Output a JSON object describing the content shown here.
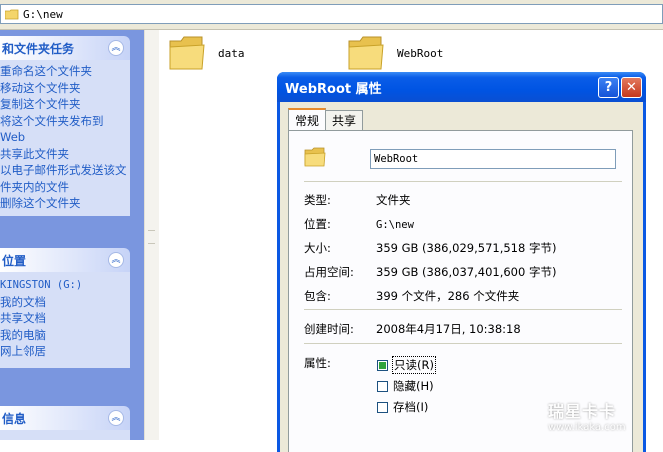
{
  "address": {
    "path": "G:\\new"
  },
  "taskpane": {
    "file_tasks": {
      "title": "和文件夹任务",
      "items": [
        "重命名这个文件夹",
        "移动这个文件夹",
        "复制这个文件夹",
        "将这个文件夹发布到 Web",
        "共享此文件夹",
        "以电子邮件形式发送该文件夹内的文件",
        "删除这个文件夹"
      ]
    },
    "other_places": {
      "title": "位置",
      "items": [
        "KINGSTON (G:)",
        "我的文档",
        "共享文档",
        "我的电脑",
        "网上邻居"
      ]
    },
    "details": {
      "title": "信息"
    }
  },
  "folders": [
    {
      "name": "data"
    },
    {
      "name": "WebRoot"
    }
  ],
  "dialog": {
    "title": "WebRoot 属性",
    "help_label": "?",
    "close_label": "✕",
    "tabs": [
      "常规",
      "共享"
    ],
    "name_value": "WebRoot",
    "rows": {
      "type": {
        "label": "类型:",
        "value": "文件夹"
      },
      "location": {
        "label": "位置:",
        "value": "G:\\new"
      },
      "size": {
        "label": "大小:",
        "value": "359 GB (386,029,571,518 字节)"
      },
      "size_on_disk": {
        "label": "占用空间:",
        "value": "359 GB (386,037,401,600 字节)"
      },
      "contains": {
        "label": "包含:",
        "value": "399 个文件，286 个文件夹"
      },
      "created": {
        "label": "创建时间:",
        "value": "2008年4月17日, 10:38:18"
      },
      "attributes": {
        "label": "属性:"
      }
    },
    "attributes": [
      {
        "label": "只读(R)",
        "state": "mixed"
      },
      {
        "label": "隐藏(H)",
        "state": "unchecked"
      },
      {
        "label": "存档(I)",
        "state": "unchecked"
      }
    ]
  },
  "watermark": {
    "top": "瑞星卡卡",
    "bottom": "www.ikaka.com"
  },
  "colors": {
    "titlebar": "#0054e3",
    "taskpane": "#7a96df",
    "panel_body": "#d6dff7",
    "link": "#215dc6",
    "dialog_bg": "#ece9d8"
  }
}
